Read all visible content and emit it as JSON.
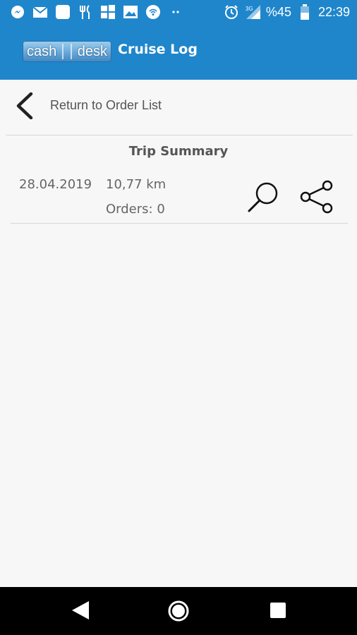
{
  "status_bar": {
    "battery_percent": "%45",
    "time": "22:39",
    "network": "3G",
    "left_icons": [
      "messenger-icon",
      "gmail-icon",
      "app-square-icon",
      "restaurant-icon",
      "windows-icon",
      "image-icon",
      "wifi-app-icon",
      "more-dots-icon"
    ],
    "right_icons": [
      "alarm-icon",
      "signal-icon",
      "battery-icon"
    ]
  },
  "app_bar": {
    "logo_left": "cash",
    "logo_right": "desk",
    "title": "Cruise Log"
  },
  "return_row": {
    "label": "Return to  Order List"
  },
  "trip_summary": {
    "title": "Trip Summary",
    "date": "28.04.2019",
    "distance": "10,77 km",
    "orders": "Orders: 0"
  },
  "nav_bar": {
    "buttons": [
      "back",
      "home",
      "recents"
    ]
  },
  "colors": {
    "primary": "#1f86cc",
    "background": "#f7f7f7",
    "nav_bar": "#000000",
    "text": "#555555"
  }
}
